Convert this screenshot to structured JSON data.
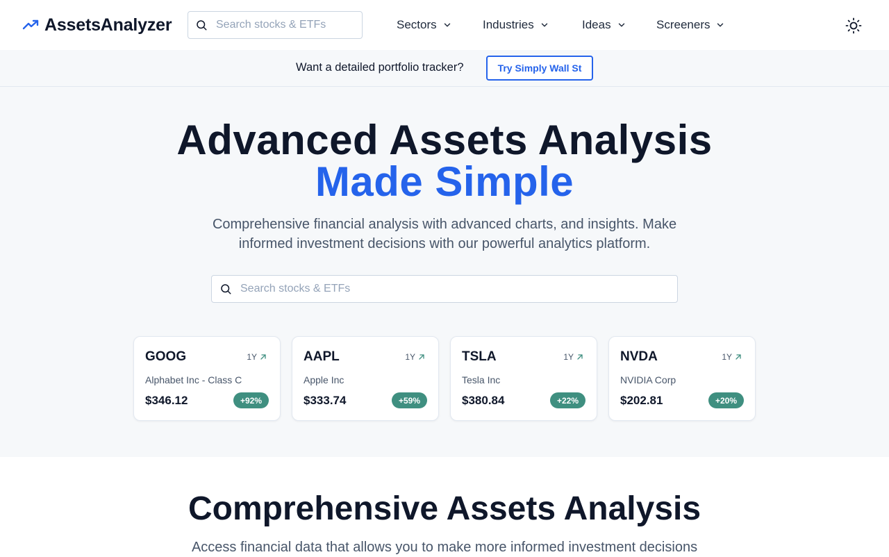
{
  "brand": {
    "name": "AssetsAnalyzer",
    "icon": "trending-up-icon",
    "accent": "#2563eb"
  },
  "nav": {
    "search_placeholder": "Search stocks & ETFs",
    "menus": [
      "Sectors",
      "Industries",
      "Ideas",
      "Screeners"
    ],
    "theme_icon": "sun-icon"
  },
  "banner": {
    "text": "Want a detailed portfolio tracker?",
    "button": "Try Simply Wall St"
  },
  "hero": {
    "title_line1": "Advanced Assets Analysis",
    "title_line2": "Made Simple",
    "subtitle": "Comprehensive financial analysis with advanced charts, and insights. Make informed investment decisions with our powerful analytics platform.",
    "search_placeholder": "Search stocks & ETFs"
  },
  "cards": [
    {
      "ticker": "GOOG",
      "period": "1Y",
      "name": "Alphabet Inc - Class C",
      "price": "$346.12",
      "change": "+92%"
    },
    {
      "ticker": "AAPL",
      "period": "1Y",
      "name": "Apple Inc",
      "price": "$333.74",
      "change": "+59%"
    },
    {
      "ticker": "TSLA",
      "period": "1Y",
      "name": "Tesla Inc",
      "price": "$380.84",
      "change": "+22%"
    },
    {
      "ticker": "NVDA",
      "period": "1Y",
      "name": "NVIDIA Corp",
      "price": "$202.81",
      "change": "+20%"
    }
  ],
  "section2": {
    "title": "Comprehensive Assets Analysis",
    "subtitle": "Access financial data that allows you to make more informed investment decisions"
  },
  "colors": {
    "positive_badge": "#3f8f80",
    "hero_bg": "#f6f8fa"
  }
}
